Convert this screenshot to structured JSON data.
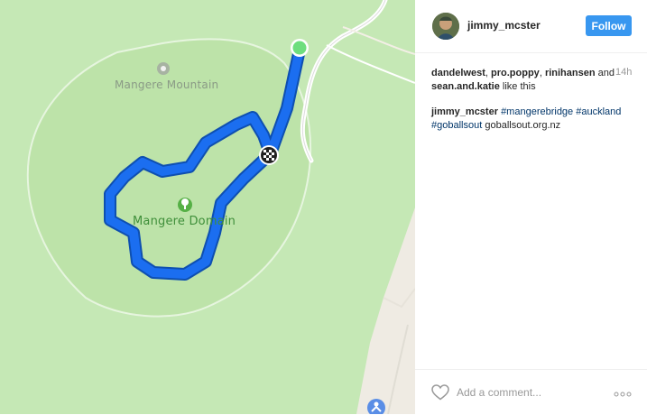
{
  "map": {
    "labels": {
      "mountain": "Mangere Mountain",
      "domain": "Mangere Domain"
    },
    "icons": [
      "pin-icon",
      "tree-icon",
      "start-marker-icon",
      "finish-flag-icon",
      "person-icon"
    ],
    "colors": {
      "land": "#c5e8b5",
      "park": "#bde3a9",
      "urban": "#efebe3",
      "route": "#1464d8",
      "start": "#6ede7e"
    }
  },
  "post": {
    "username": "jimmy_mcster",
    "follow_label": "Follow",
    "likes": {
      "names": [
        "dandelwest",
        "pro.poppy",
        "rinihansen"
      ],
      "last_name": "sean.and.katie",
      "suffix": "like this"
    },
    "time": "14h",
    "caption": {
      "user": "jimmy_mcster",
      "tag1": "#mangerebridge",
      "tag2": "#auckland",
      "tag3": "#goballsout",
      "link": "goballsout.org.nz"
    },
    "comment_placeholder": "Add a comment...",
    "colors": {
      "follow": "#3897f0",
      "text": "#262626",
      "tag": "#003569"
    }
  }
}
